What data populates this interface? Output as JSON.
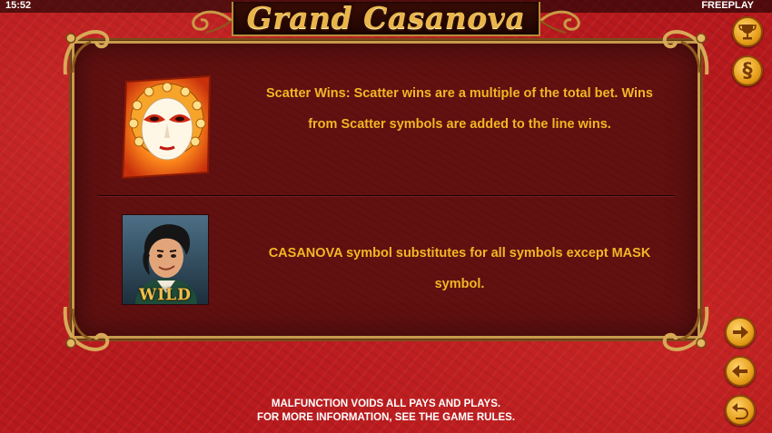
{
  "status_bar": {
    "time": "15:52",
    "mode": "FREEPLAY"
  },
  "logo": {
    "title": "Grand Casanova"
  },
  "rows": [
    {
      "symbol": "mask-scatter",
      "text": "Scatter Wins: Scatter wins are a multiple of the total bet. Wins from Scatter symbols are added to the line wins."
    },
    {
      "symbol": "casanova-wild",
      "symbol_label": "WILD",
      "text": "CASANOVA symbol substitutes for all symbols except MASK symbol."
    }
  ],
  "side_buttons": {
    "top": [
      "trophy-icon",
      "section-icon"
    ],
    "bottom": [
      "arrow-right-icon",
      "arrow-left-icon",
      "return-icon"
    ],
    "rules_glyph": "§"
  },
  "footer": {
    "line1": "MALFUNCTION VOIDS ALL PAYS AND PLAYS.",
    "line2": "FOR MORE INFORMATION, SEE THE GAME RULES."
  },
  "colors": {
    "background": "#b8191d",
    "panel": "#621010",
    "text_gold": "#f3b625",
    "button_gold": "#e79e1a"
  }
}
